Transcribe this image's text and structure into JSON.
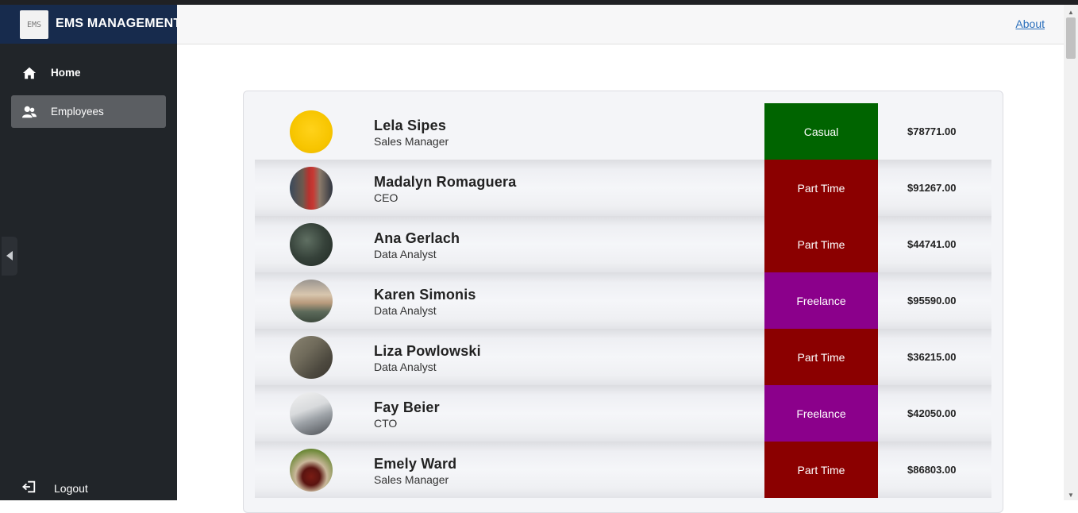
{
  "app": {
    "title": "EMS MANAGEMENT",
    "logo_text": "EMS"
  },
  "sidebar": {
    "items": [
      {
        "label": "Home",
        "icon": "home-icon",
        "active": false
      },
      {
        "label": "Employees",
        "icon": "employees-icon",
        "active": true
      }
    ],
    "logout_label": "Logout"
  },
  "header": {
    "about_label": "About"
  },
  "colors": {
    "casual": "#006400",
    "part_time": "#8b0000",
    "freelance": "#8b008b",
    "brand_bar": "#172b4d",
    "sidebar": "#212529"
  },
  "employees": [
    {
      "name": "Lela Sipes",
      "title": "Sales Manager",
      "type": "Casual",
      "salary": "$78771.00"
    },
    {
      "name": "Madalyn Romaguera",
      "title": "CEO",
      "type": "Part Time",
      "salary": "$91267.00"
    },
    {
      "name": "Ana Gerlach",
      "title": "Data Analyst",
      "type": "Part Time",
      "salary": "$44741.00"
    },
    {
      "name": "Karen Simonis",
      "title": "Data Analyst",
      "type": "Freelance",
      "salary": "$95590.00"
    },
    {
      "name": "Liza Powlowski",
      "title": "Data Analyst",
      "type": "Part Time",
      "salary": "$36215.00"
    },
    {
      "name": "Fay Beier",
      "title": "CTO",
      "type": "Freelance",
      "salary": "$42050.00"
    },
    {
      "name": "Emely Ward",
      "title": "Sales Manager",
      "type": "Part Time",
      "salary": "$86803.00"
    }
  ]
}
